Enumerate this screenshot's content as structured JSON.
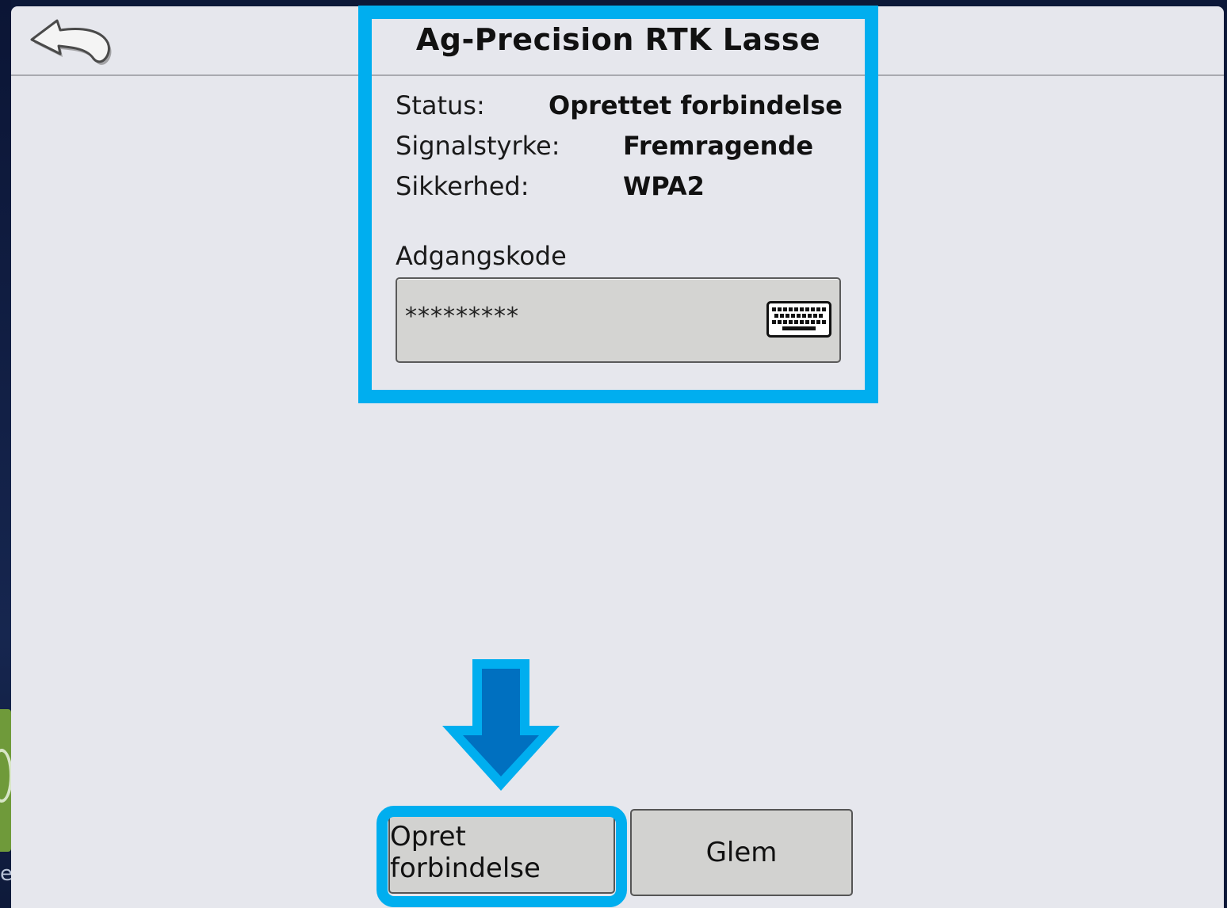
{
  "dialog": {
    "title": "Ag-Precision RTK Lasse",
    "status_label": "Status:",
    "status_value": "Oprettet forbindelse",
    "signal_label": "Signalstyrke:",
    "signal_value": "Fremragende",
    "security_label": "Sikkerhed:",
    "security_value": "WPA2",
    "password_label": "Adgangskode",
    "password_value": "*********"
  },
  "buttons": {
    "connect": "Opret forbindelse",
    "forget": "Glem"
  },
  "background": {
    "stray_text": "e"
  },
  "icons": {
    "back": "back-arrow-icon",
    "keyboard": "keyboard-icon",
    "callout": "arrow-down-icon"
  },
  "colors": {
    "highlight": "#00aeef",
    "arrow_fill": "#0070c0",
    "panel": "#e6e7ed",
    "button": "#d2d2d0"
  }
}
